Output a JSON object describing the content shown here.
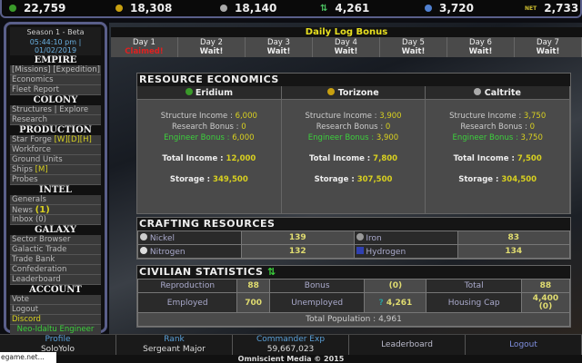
{
  "resources": [
    {
      "name": "eridium",
      "value": "22,759",
      "color": "#3a9a2a"
    },
    {
      "name": "torizone",
      "value": "18,308",
      "color": "#c8a010"
    },
    {
      "name": "caltrite",
      "value": "18,140",
      "color": "#aaaaaa"
    },
    {
      "name": "population",
      "value": "4,261",
      "color": "#4ac060",
      "glyph": "⇅"
    },
    {
      "name": "hydrogen",
      "value": "3,720",
      "color": "#5080d0"
    },
    {
      "name": "net",
      "value": "2,733",
      "color": "#d0c030",
      "glyph": "NET"
    }
  ],
  "sidebar": {
    "season": "Season 1 - Beta",
    "time": "05:44:10 pm | 01/02/2019",
    "sections": [
      {
        "title": "EMPIRE",
        "items": [
          "[Missions] [Expedition]",
          "Economics",
          "Fleet Report"
        ]
      },
      {
        "title": "COLONY",
        "items": [
          "Structures | Explore",
          "Research"
        ]
      },
      {
        "title": "PRODUCTION",
        "items": [
          "Star Forge ",
          "Workforce",
          "Ground Units",
          "Ships "
        ]
      },
      {
        "title": "INTEL",
        "items": [
          "Generals",
          "News ",
          "Inbox (0)"
        ]
      },
      {
        "title": "GALAXY",
        "items": [
          "Sector Browser",
          "Galactic Trade",
          "Trade Bank",
          "Confederation",
          "Leaderboard"
        ]
      },
      {
        "title": "ACCOUNT",
        "items": [
          "Vote",
          "Logout"
        ]
      }
    ],
    "star_forge_links": "[W][D][H]",
    "ships_link": "[M]",
    "news_count": "(1)",
    "probes": "Probes",
    "discord": "Discord",
    "race": "Neo-Idaltu Engineer"
  },
  "daily": {
    "title": "Daily Log Bonus",
    "days": [
      {
        "label": "Day 1",
        "status": "Claimed!"
      },
      {
        "label": "Day 2",
        "status": "Wait!"
      },
      {
        "label": "Day 3",
        "status": "Wait!"
      },
      {
        "label": "Day 4",
        "status": "Wait!"
      },
      {
        "label": "Day 5",
        "status": "Wait!"
      },
      {
        "label": "Day 6",
        "status": "Wait!"
      },
      {
        "label": "Day 7",
        "status": "Wait!"
      }
    ]
  },
  "economics": {
    "title": "RESOURCE ECONOMICS",
    "columns": [
      {
        "name": "Eridium",
        "color": "#3a9a2a",
        "structure": "6,000",
        "research": "0",
        "engineer": "6,000",
        "total": "12,000",
        "storage": "349,500"
      },
      {
        "name": "Torizone",
        "color": "#c8a010",
        "structure": "3,900",
        "research": "0",
        "engineer": "3,900",
        "total": "7,800",
        "storage": "307,500"
      },
      {
        "name": "Caltrite",
        "color": "#aaaaaa",
        "structure": "3,750",
        "research": "0",
        "engineer": "3,750",
        "total": "7,500",
        "storage": "304,500"
      }
    ],
    "labels": {
      "structure": "Structure Income : ",
      "research": "Research Bonus : ",
      "engineer": "Engineer Bonus : ",
      "total": "Total Income : ",
      "storage": "Storage : "
    }
  },
  "crafting": {
    "title": "CRAFTING RESOURCES",
    "items": [
      {
        "name": "Nickel",
        "value": "139"
      },
      {
        "name": "Iron",
        "value": "83"
      },
      {
        "name": "Nitrogen",
        "value": "132"
      },
      {
        "name": "Hydrogen",
        "value": "134"
      }
    ]
  },
  "civilian": {
    "title": "CIVILIAN STATISTICS",
    "reproduction_label": "Reproduction",
    "reproduction": "88",
    "bonus_label": "Bonus",
    "bonus": "(0)",
    "total_label": "Total",
    "total": "88",
    "employed_label": "Employed",
    "employed": "700",
    "unemployed_label": "Unemployed",
    "unemployed": "4,261",
    "housing_label": "Housing Cap",
    "housing": "4,400",
    "housing_sub": "(0)",
    "total_population": "Total Population : 4,961"
  },
  "footer": {
    "profile_label": "Profile",
    "profile": "SoloYolo",
    "rank_label": "Rank",
    "rank": "Sergeant Major",
    "exp_label": "Commander Exp",
    "exp": "59,667,023",
    "leaderboard": "Leaderboard",
    "logout": "Logout",
    "copyright": "Omniscient Media © 2015",
    "status_url": "egame.net..."
  }
}
